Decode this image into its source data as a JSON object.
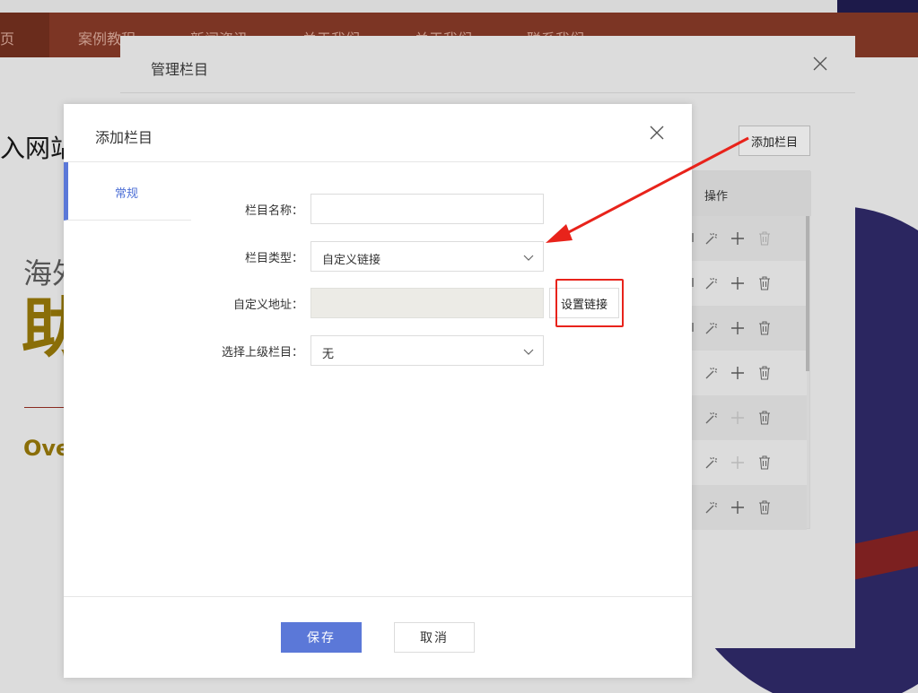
{
  "background_site": {
    "nav_items": [
      "页",
      "案例教程",
      "新闻资讯",
      "关于我们",
      "关于我们",
      "联系我们"
    ],
    "heading": "入网站",
    "sub1": "海外",
    "sub2": "助",
    "sub3": "Ove"
  },
  "manage_modal": {
    "title": "管理栏目",
    "add_button": "添加栏目",
    "table_header": "操作",
    "rows": [
      {
        "plus_disabled": false
      },
      {
        "plus_disabled": false
      },
      {
        "plus_disabled": false
      },
      {
        "plus_disabled": false
      },
      {
        "plus_disabled": true
      },
      {
        "plus_disabled": true
      },
      {
        "plus_disabled": false
      }
    ]
  },
  "add_modal": {
    "title": "添加栏目",
    "tabs": [
      {
        "label": "常规"
      }
    ],
    "fields": {
      "name": {
        "label": "栏目名称：",
        "value": ""
      },
      "type": {
        "label": "栏目类型：",
        "value": "自定义链接"
      },
      "url": {
        "label": "自定义地址：",
        "value": ""
      },
      "parent": {
        "label": "选择上级栏目：",
        "value": "无"
      }
    },
    "set_link_button": "设置链接",
    "save_button": "保存",
    "cancel_button": "取消"
  },
  "colors": {
    "primary": "#5b78d8",
    "annotation_red": "#e8231b",
    "nav_brown": "#7c3524"
  }
}
